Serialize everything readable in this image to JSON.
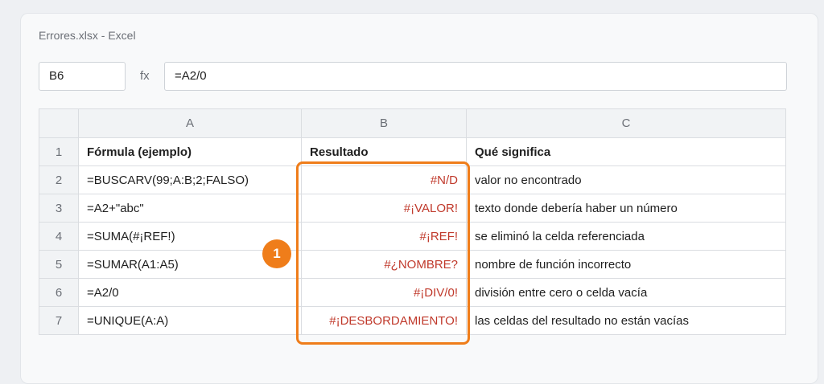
{
  "window": {
    "title": "Errores.xlsx - Excel"
  },
  "formula_bar": {
    "cell_ref": "B6",
    "fx_label": "fx",
    "formula": "=A2/0"
  },
  "sheet": {
    "column_headers": [
      "A",
      "B",
      "C"
    ],
    "rows": [
      {
        "num": "1",
        "a": "Fórmula (ejemplo)",
        "b": "Resultado",
        "c": "Qué significa"
      },
      {
        "num": "2",
        "a": "=BUSCARV(99;A:B;2;FALSO)",
        "b": "#N/D",
        "c": "valor no encontrado"
      },
      {
        "num": "3",
        "a": "=A2+\"abc\"",
        "b": "#¡VALOR!",
        "c": "texto donde debería haber un número"
      },
      {
        "num": "4",
        "a": "=SUMA(#¡REF!)",
        "b": "#¡REF!",
        "c": "se eliminó la celda referenciada"
      },
      {
        "num": "5",
        "a": "=SUMAR(A1:A5)",
        "b": "#¿NOMBRE?",
        "c": "nombre de función incorrecto"
      },
      {
        "num": "6",
        "a": "=A2/0",
        "b": "#¡DIV/0!",
        "c": "división entre cero o celda vacía"
      },
      {
        "num": "7",
        "a": "=UNIQUE(A:A)",
        "b": "#¡DESBORDAMIENTO!",
        "c": "las celdas del resultado no están vacías"
      }
    ]
  },
  "callout": {
    "number": "1"
  },
  "colors": {
    "accent": "#ef7d1a",
    "error_text": "#c0392b"
  }
}
